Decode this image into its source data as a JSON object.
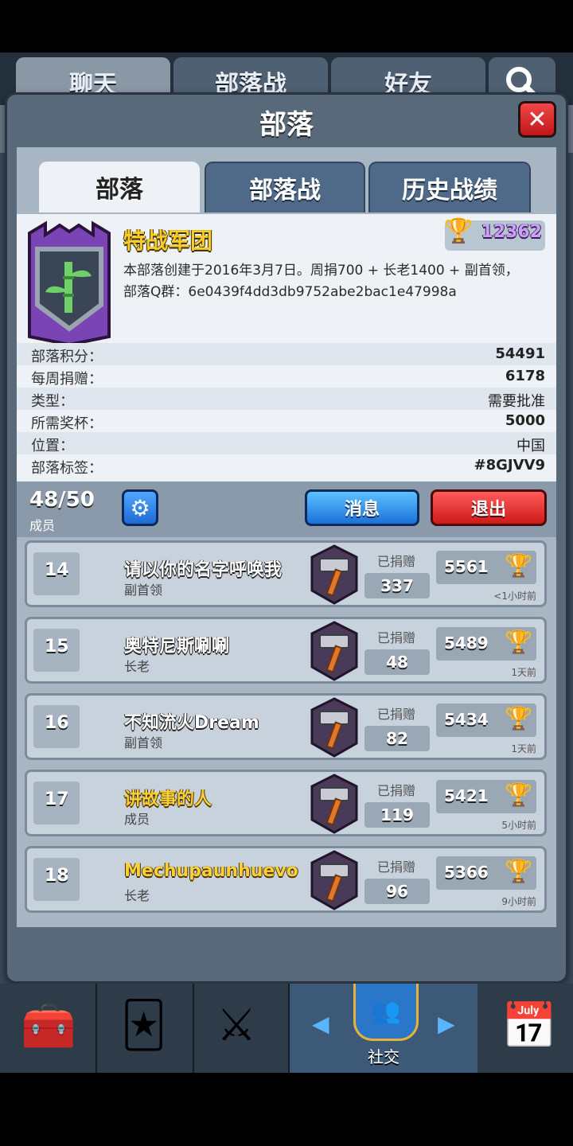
{
  "top_tabs": [
    "聊天",
    "部落战",
    "好友"
  ],
  "modal": {
    "title": "部落",
    "close": "✕",
    "tabs": [
      "部落",
      "部落战",
      "历史战绩"
    ]
  },
  "clan": {
    "name": "特战军团",
    "trophies": "12362",
    "description_line1": "本部落创建于2016年3月7日。周捐700 + 长老1400 + 副首领，",
    "description_line2": "部落Q群：6e0439f4dd3db9752abe2bac1e47998a"
  },
  "stats": [
    {
      "label": "部落积分：",
      "value": "54491"
    },
    {
      "label": "每周捐赠：",
      "value": "6178"
    },
    {
      "label": "类型：",
      "value": "需要批准"
    },
    {
      "label": "所需奖杯：",
      "value": "5000"
    },
    {
      "label": "位置：",
      "value": "中国"
    },
    {
      "label": "部落标签：",
      "value": "#8GJVV9"
    }
  ],
  "members_bar": {
    "count": "48/50",
    "label": "成员",
    "message_btn": "消息",
    "leave_btn": "退出"
  },
  "members": [
    {
      "rank": "14",
      "name": "请以你的名字呼唤我",
      "role": "副首领",
      "donated_label": "已捐赠",
      "donated": "337",
      "trophies": "5561",
      "time": "<1小时前",
      "gold": false
    },
    {
      "rank": "15",
      "name": "奥特尼斯唰唰",
      "role": "长老",
      "donated_label": "已捐赠",
      "donated": "48",
      "trophies": "5489",
      "time": "1天前",
      "gold": false
    },
    {
      "rank": "16",
      "name": "不知流火Dream",
      "role": "副首领",
      "donated_label": "已捐赠",
      "donated": "82",
      "trophies": "5434",
      "time": "1天前",
      "gold": false
    },
    {
      "rank": "17",
      "name": "讲故事的人",
      "role": "成员",
      "donated_label": "已捐赠",
      "donated": "119",
      "trophies": "5421",
      "time": "5小时前",
      "gold": true
    },
    {
      "rank": "18",
      "name": "Mechupaunhuevo",
      "role": "长老",
      "donated_label": "已捐赠",
      "donated": "96",
      "trophies": "5366",
      "time": "9小时前",
      "gold": true
    }
  ],
  "bottom_nav": {
    "social_label": "社交"
  },
  "colors": {
    "accent_blue": "#1e6ad4",
    "danger_red": "#cf1a1a",
    "clan_purple": "#6b3fa0",
    "gold": "#f6cd2a"
  }
}
